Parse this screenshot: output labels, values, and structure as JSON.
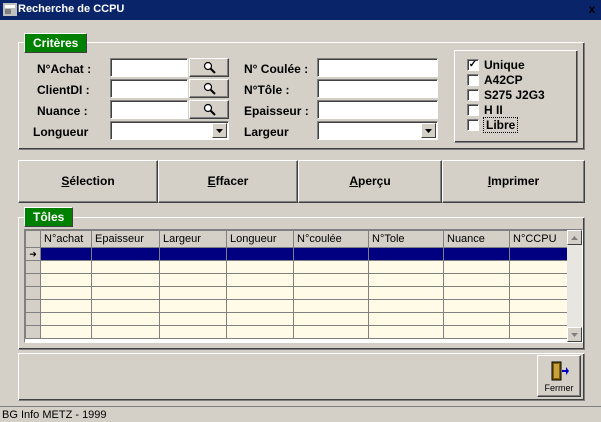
{
  "window": {
    "title": "Recherche de CCPU",
    "close_label": "x"
  },
  "criteria": {
    "group_label": "Critères",
    "fields": {
      "achat": {
        "label": "N°Achat :",
        "value": ""
      },
      "clientdi": {
        "label": "ClientDI :",
        "value": ""
      },
      "nuance": {
        "label": "Nuance :",
        "value": ""
      },
      "longueur": {
        "label": "Longueur",
        "value": ""
      },
      "coulee": {
        "label": "N° Coulée :",
        "value": ""
      },
      "tole": {
        "label": "N°Tôle :",
        "value": ""
      },
      "epaisseur": {
        "label": "Epaisseur :",
        "value": ""
      },
      "largeur": {
        "label": "Largeur",
        "value": ""
      }
    },
    "checkboxes": [
      {
        "label": "Unique",
        "checked": true,
        "mark": "✓"
      },
      {
        "label": "A42CP",
        "checked": false,
        "mark": ""
      },
      {
        "label": "S275 J2G3",
        "checked": false,
        "mark": ""
      },
      {
        "label": "H II",
        "checked": false,
        "mark": ""
      },
      {
        "label": "Libre",
        "checked": false,
        "mark": ""
      }
    ]
  },
  "actions": {
    "selection": {
      "key": "S",
      "rest": "élection"
    },
    "effacer": {
      "key": "E",
      "rest": "ffacer"
    },
    "apercu": {
      "key": "A",
      "rest": "perçu"
    },
    "imprimer": {
      "key": "I",
      "rest": "mprimer"
    }
  },
  "toles": {
    "group_label": "Tôles",
    "columns": [
      "N°achat",
      "Epaisseur",
      "Largeur",
      "Longueur",
      "N°coulée",
      "N°Tole",
      "Nuance",
      "N°CCPU"
    ],
    "current_row_marker": "➜"
  },
  "footer": {
    "close_label": "Fermer"
  },
  "status": {
    "text": "BG Info METZ - 1999"
  },
  "colors": {
    "title_bar": "#0a246a",
    "group_label": "#008000",
    "selected_row": "#000080",
    "grid_row": "#fffbe6",
    "face": "#d4d0c8"
  }
}
